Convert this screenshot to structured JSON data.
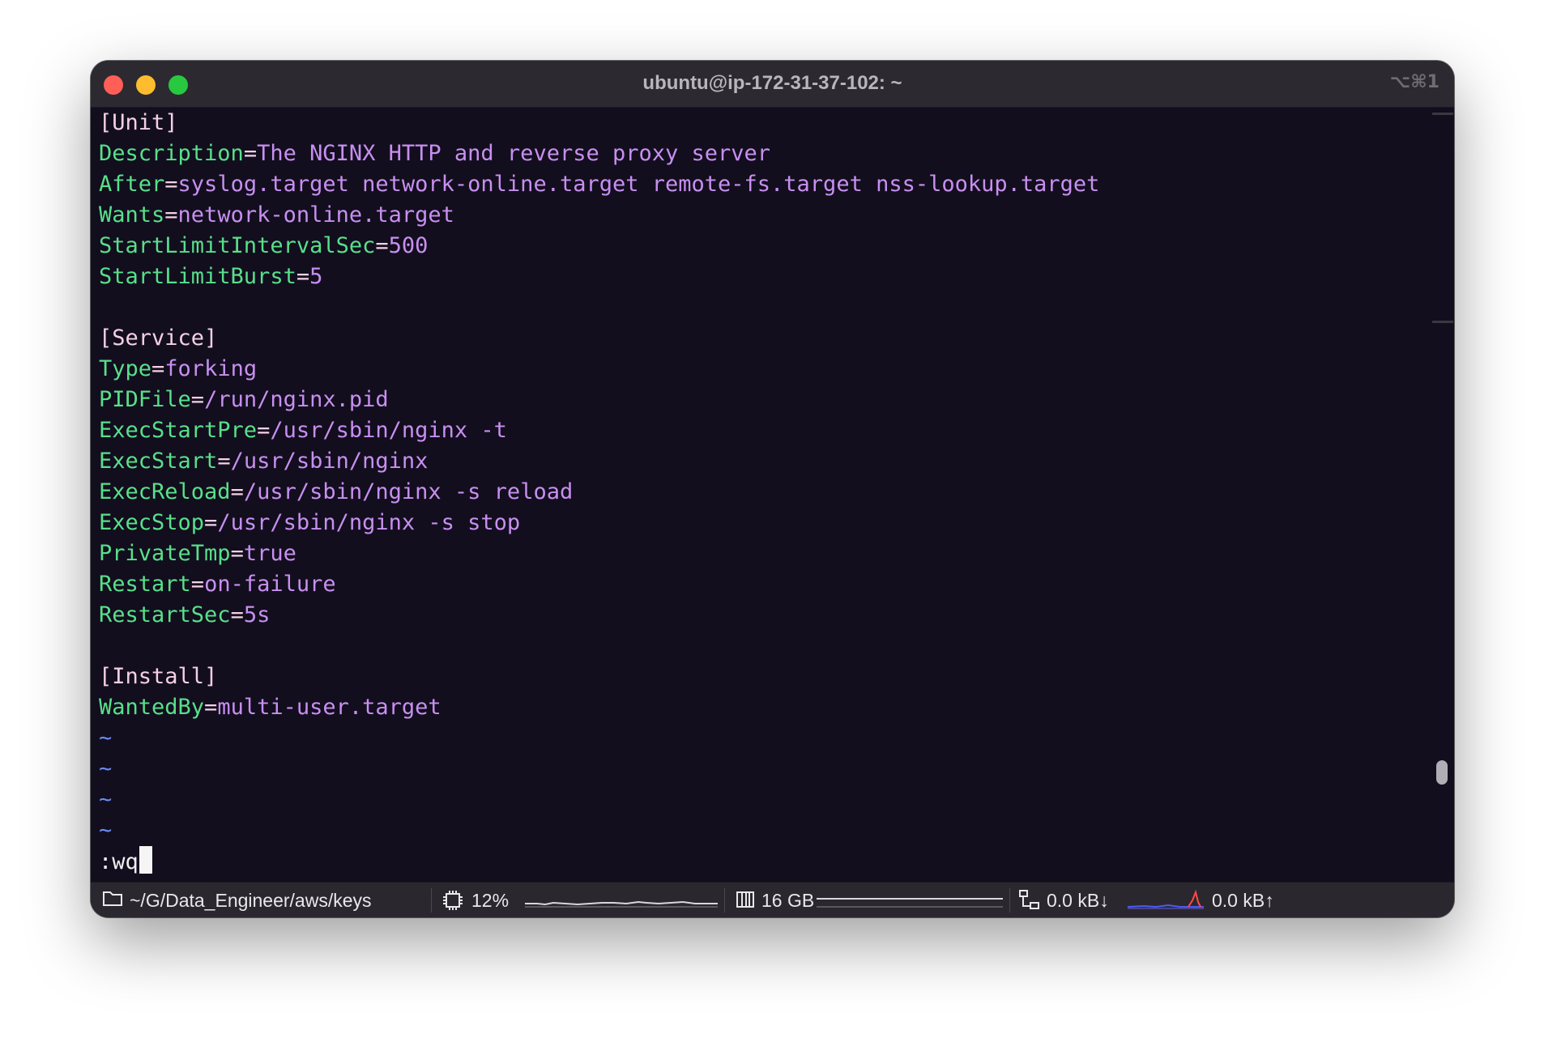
{
  "window": {
    "title": "ubuntu@ip-172-31-37-102: ~",
    "shortcut": "⌥⌘1"
  },
  "editor": {
    "lines": [
      {
        "type": "section",
        "text": "[Unit]"
      },
      {
        "type": "kv",
        "key": "Description",
        "value": "The NGINX HTTP and reverse proxy server"
      },
      {
        "type": "kv",
        "key": "After",
        "value": "syslog.target network-online.target remote-fs.target nss-lookup.target"
      },
      {
        "type": "kv",
        "key": "Wants",
        "value": "network-online.target"
      },
      {
        "type": "kv",
        "key": "StartLimitIntervalSec",
        "value": "500"
      },
      {
        "type": "kv",
        "key": "StartLimitBurst",
        "value": "5"
      },
      {
        "type": "blank"
      },
      {
        "type": "section",
        "text": "[Service]"
      },
      {
        "type": "kv",
        "key": "Type",
        "value": "forking"
      },
      {
        "type": "kv",
        "key": "PIDFile",
        "value": "/run/nginx.pid"
      },
      {
        "type": "kv",
        "key": "ExecStartPre",
        "value": "/usr/sbin/nginx -t"
      },
      {
        "type": "kv",
        "key": "ExecStart",
        "value": "/usr/sbin/nginx"
      },
      {
        "type": "kv",
        "key": "ExecReload",
        "value": "/usr/sbin/nginx -s reload"
      },
      {
        "type": "kv",
        "key": "ExecStop",
        "value": "/usr/sbin/nginx -s stop"
      },
      {
        "type": "kv",
        "key": "PrivateTmp",
        "value": "true"
      },
      {
        "type": "kv",
        "key": "Restart",
        "value": "on-failure"
      },
      {
        "type": "kv",
        "key": "RestartSec",
        "value": "5s"
      },
      {
        "type": "blank"
      },
      {
        "type": "section",
        "text": "[Install]"
      },
      {
        "type": "kv",
        "key": "WantedBy",
        "value": "multi-user.target"
      },
      {
        "type": "tilde",
        "text": "~"
      },
      {
        "type": "tilde",
        "text": "~"
      },
      {
        "type": "tilde",
        "text": "~"
      },
      {
        "type": "tilde",
        "text": "~"
      }
    ],
    "command": ":wq"
  },
  "statusbar": {
    "path": "~/G/Data_Engineer/aws/keys",
    "cpu": "12%",
    "memory": "16 GB",
    "net_down": "0.0 kB↓",
    "net_up": "0.0 kB↑"
  },
  "icons": {
    "folder": "folder-icon",
    "cpu": "cpu-chip-icon",
    "memory": "memory-icon",
    "network": "network-icon"
  },
  "colors": {
    "background": "#120e1e",
    "key": "#58e08a",
    "value": "#c88ff0",
    "section": "#f5d0e4",
    "tilde": "#6a8cf0"
  }
}
